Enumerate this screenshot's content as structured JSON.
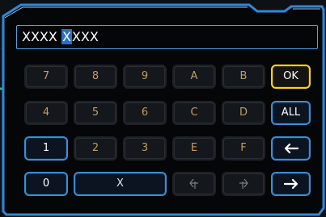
{
  "input": {
    "text_before": "XXXX ",
    "selected": "X",
    "text_after": "XXX"
  },
  "keys": {
    "k7": "7",
    "k8": "8",
    "k9": "9",
    "kA": "A",
    "kB": "B",
    "ok": "OK",
    "k4": "4",
    "k5": "5",
    "k6": "6",
    "kC": "C",
    "kD": "D",
    "all": "ALL",
    "k1": "1",
    "k2": "2",
    "k3": "3",
    "kE": "E",
    "kF": "F",
    "k0": "0",
    "x": "X"
  },
  "icons": {
    "backspace": "arrow-left-icon",
    "forward": "arrow-right-icon",
    "cursor_left": "cursor-left-icon",
    "cursor_right": "cursor-right-icon"
  },
  "colors": {
    "accent_blue": "#3a8fd8",
    "ok_yellow": "#ffd21a",
    "digit_text": "#c59a64"
  }
}
